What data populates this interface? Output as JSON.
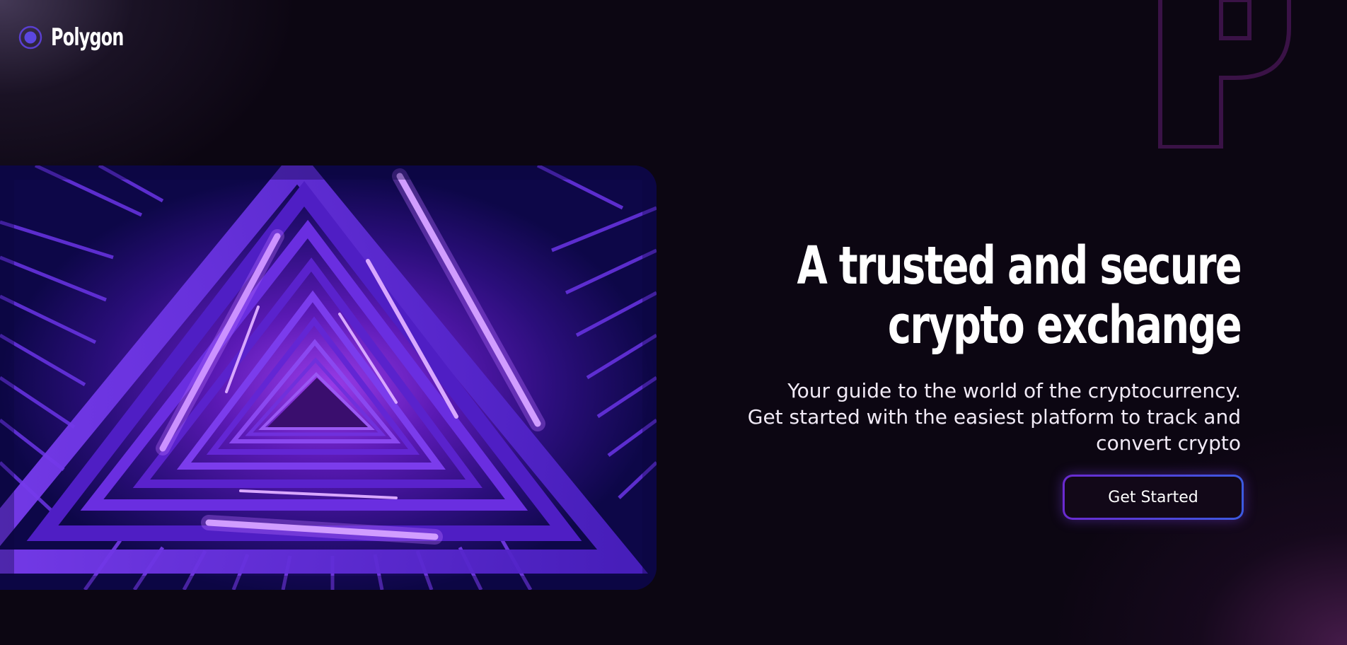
{
  "brand": {
    "name": "Polygon",
    "logo_icon": "polygon-ring-icon",
    "accent": "#6a2ad0"
  },
  "hero": {
    "headline_line1": "A trusted and secure",
    "headline_line2": "crypto exchange",
    "subtitle_line1": "Your guide to the world of the cryptocurrency.",
    "subtitle_line2": "Get started with the easiest platform to track and",
    "subtitle_line3": "convert crypto",
    "cta_label": "Get Started",
    "image": "neon-triangle-staircase"
  },
  "decor": {
    "ghost_letter": "P"
  },
  "colors": {
    "background": "#0c0612",
    "text": "#ffffff",
    "button_border_start": "#6a2ad0",
    "button_border_end": "#3b5ae0",
    "neon": "#b66cff"
  }
}
